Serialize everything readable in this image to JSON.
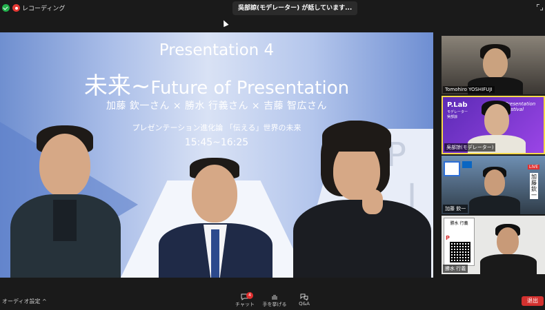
{
  "topbar": {
    "recording_label": "レコーディング",
    "speaking_status": "吳部諒(モデレーター) が話しています...",
    "security_icon": "shield-check-icon",
    "fullscreen_icon": "fullscreen-icon"
  },
  "slide": {
    "title": "Presentation 4",
    "subtitle_jp": "未来~",
    "subtitle_en": "Future of Presentation",
    "names": "加藤 欽一さん × 勝水 行義さん × 吉藤 智広さん",
    "theme": "プレゼンテーション進化論 「伝える」世界の未来",
    "time": "15:45~16:25",
    "bg_letter": "P",
    "bg_letter2": "I"
  },
  "gallery": [
    {
      "name": "Tomohiro YOSHIFUJI"
    },
    {
      "name": "吳部諒(モデレーター)"
    },
    {
      "name": "加藤 欽一"
    },
    {
      "name": "勝水 行義"
    }
  ],
  "gallery_text": {
    "logo_label": "P.Lab",
    "logo_sub": "モデレーター\n吳部諒",
    "event_banner": "Presentation Festival",
    "live_badge": "LIVE",
    "vertical_name": "加藤欽一",
    "qr_note": "P",
    "card_title": "勝水 行義"
  },
  "bottombar": {
    "audio_settings": "オーディオ設定",
    "chat_label": "チャット",
    "chat_badge": "4",
    "raise_hand_label": "手を挙げる",
    "qa_label": "Q&A",
    "leave_label": "退出"
  },
  "colors": {
    "leave_red": "#d3312f",
    "active_speaker": "#f6d94a",
    "slide_blue": "#6f8fd0"
  }
}
